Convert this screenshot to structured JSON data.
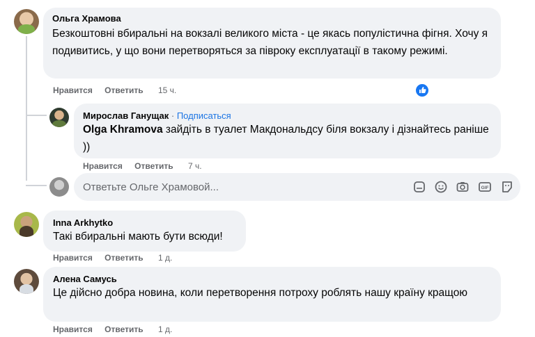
{
  "comments": [
    {
      "author": "Ольга Храмова",
      "text": "Безкоштовні вбиральні на вокзалі великого міста - це якась популістична фігня. Хочу я подивитись, у що вони перетворяться за півроку експлуатації в такому режимі.",
      "like": "Нравится",
      "reply": "Ответить",
      "time": "15 ч."
    },
    {
      "author": "Мирослав Ганущак",
      "separator": "·",
      "follow": "Подписаться",
      "mention": "Olga Khramova",
      "text": " зайдіть в туалет Макдональдсу біля вокзалу і дізнайтесь раніше ))",
      "like": "Нравится",
      "reply": "Ответить",
      "time": "7 ч."
    },
    {
      "author": "Inna Arkhytko",
      "text": "Такі вбиральні мають бути всюди!",
      "like": "Нравится",
      "reply": "Ответить",
      "time": "1 д."
    },
    {
      "author": "Алена Самусь",
      "text": "Це дійсно добра новина, коли перетворення потроху роблять нашу країну кращою",
      "like": "Нравится",
      "reply": "Ответить",
      "time": "1 д."
    }
  ],
  "reply_box": {
    "placeholder": "Ответьте Ольге Храмовой..."
  },
  "icons": {
    "like_reaction": "like-icon",
    "toolbar": [
      "sticker-icon",
      "emoji-icon",
      "camera-icon",
      "gif-icon",
      "sticker-face-icon"
    ]
  },
  "colors": {
    "bubble": "#f0f2f5",
    "secondary_text": "#65676b",
    "link": "#1b74e4",
    "like_blue": "#1877f2"
  }
}
